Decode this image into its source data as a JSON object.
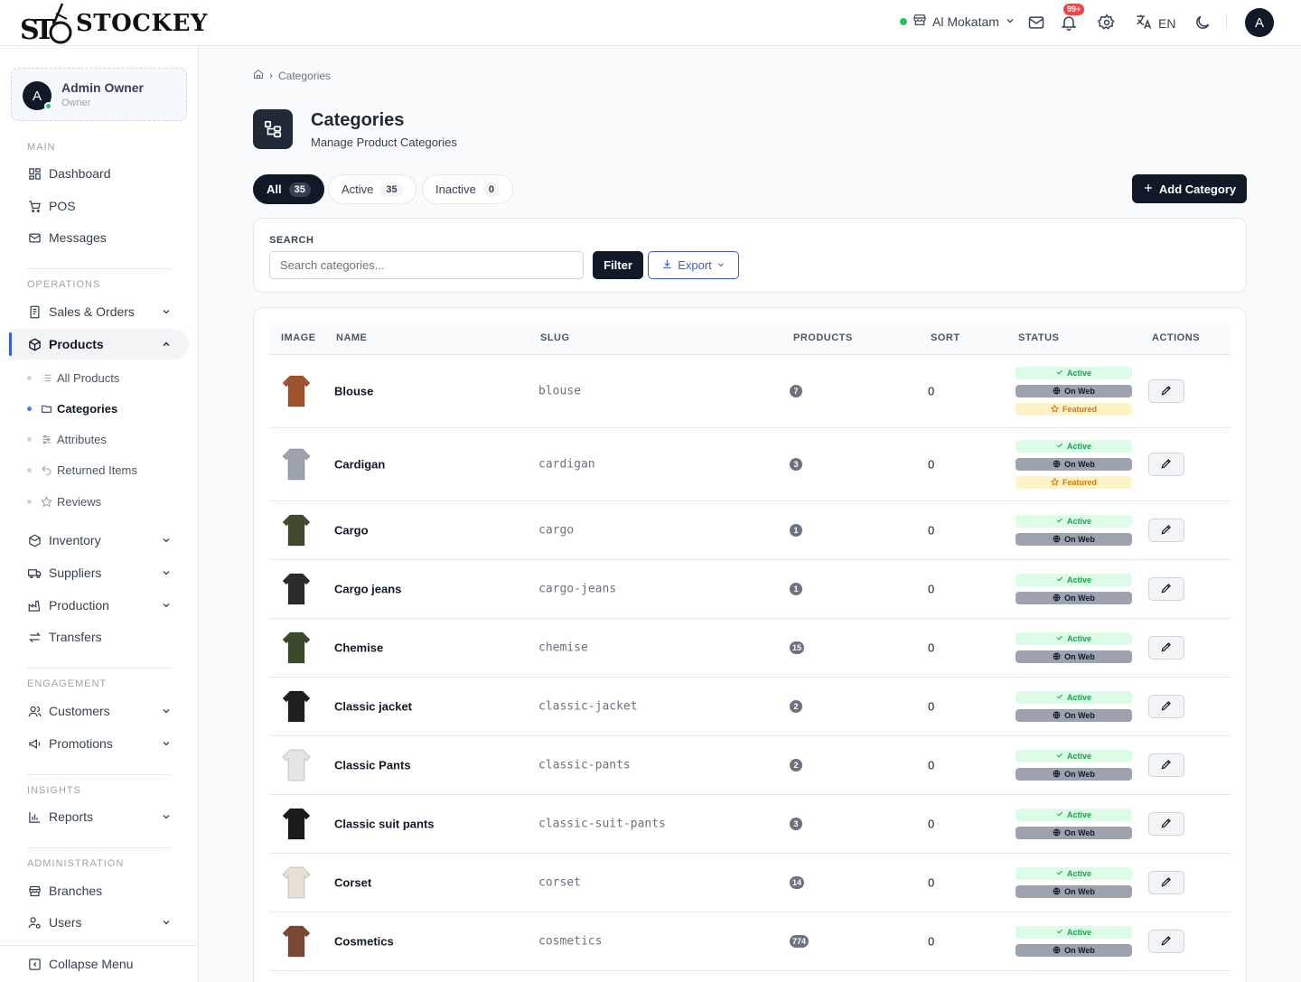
{
  "brand": {
    "name": "STOCKEY",
    "mark_text": "STC"
  },
  "topbar": {
    "branch": "Al Mokatam",
    "notifications_badge": "99+",
    "language": "EN",
    "avatar_initial": "A"
  },
  "sidebar": {
    "user": {
      "initial": "A",
      "name": "Admin Owner",
      "role": "Owner"
    },
    "sections": {
      "main": "MAIN",
      "operations": "OPERATIONS",
      "engagement": "ENGAGEMENT",
      "insights": "INSIGHTS",
      "administration": "ADMINISTRATION"
    },
    "items": {
      "dashboard": "Dashboard",
      "pos": "POS",
      "messages": "Messages",
      "sales_orders": "Sales & Orders",
      "products": "Products",
      "all_products": "All Products",
      "categories": "Categories",
      "attributes": "Attributes",
      "returned_items": "Returned Items",
      "reviews": "Reviews",
      "inventory": "Inventory",
      "suppliers": "Suppliers",
      "production": "Production",
      "transfers": "Transfers",
      "customers": "Customers",
      "promotions": "Promotions",
      "reports": "Reports",
      "branches": "Branches",
      "users": "Users"
    },
    "collapse_label": "Collapse Menu"
  },
  "breadcrumb": {
    "current": "Categories"
  },
  "page": {
    "title": "Categories",
    "subtitle": "Manage Product Categories"
  },
  "tabs": {
    "all": {
      "label": "All",
      "count": "35"
    },
    "active": {
      "label": "Active",
      "count": "35"
    },
    "inactive": {
      "label": "Inactive",
      "count": "0"
    }
  },
  "add_button": "Add Category",
  "search": {
    "label": "SEARCH",
    "placeholder": "Search categories...",
    "filter_label": "Filter",
    "export_label": "Export"
  },
  "table": {
    "headers": {
      "image": "IMAGE",
      "name": "NAME",
      "slug": "SLUG",
      "products": "PRODUCTS",
      "sort": "SORT",
      "status": "STATUS",
      "actions": "ACTIONS"
    },
    "badge_labels": {
      "active": "Active",
      "web": "On Web",
      "featured": "Featured"
    },
    "rows": [
      {
        "name": "Blouse",
        "slug": "blouse",
        "products": "7",
        "sort": "0",
        "featured": true,
        "thumb_color": "#a0522d"
      },
      {
        "name": "Cardigan",
        "slug": "cardigan",
        "products": "3",
        "sort": "0",
        "featured": true,
        "thumb_color": "#9ca3af"
      },
      {
        "name": "Cargo",
        "slug": "cargo",
        "products": "1",
        "sort": "0",
        "featured": false,
        "thumb_color": "#3f4a2f"
      },
      {
        "name": "Cargo jeans",
        "slug": "cargo-jeans",
        "products": "1",
        "sort": "0",
        "featured": false,
        "thumb_color": "#2b2b2b"
      },
      {
        "name": "Chemise",
        "slug": "chemise",
        "products": "15",
        "sort": "0",
        "featured": false,
        "thumb_color": "#3b4a2a"
      },
      {
        "name": "Classic jacket",
        "slug": "classic-jacket",
        "products": "2",
        "sort": "0",
        "featured": false,
        "thumb_color": "#1f1f1f"
      },
      {
        "name": "Classic Pants",
        "slug": "classic-pants",
        "products": "2",
        "sort": "0",
        "featured": false,
        "thumb_color": "#e5e5e5"
      },
      {
        "name": "Classic suit pants",
        "slug": "classic-suit-pants",
        "products": "3",
        "sort": "0",
        "featured": false,
        "thumb_color": "#1a1a1a"
      },
      {
        "name": "Corset",
        "slug": "corset",
        "products": "14",
        "sort": "0",
        "featured": false,
        "thumb_color": "#e8e0d6"
      },
      {
        "name": "Cosmetics",
        "slug": "cosmetics",
        "products": "774",
        "sort": "0",
        "featured": false,
        "thumb_color": "#7a4a35"
      }
    ]
  },
  "colors": {
    "primary": "#111827",
    "accent": "#3b5bdb",
    "success": "#22c55e",
    "danger": "#ef4444"
  }
}
